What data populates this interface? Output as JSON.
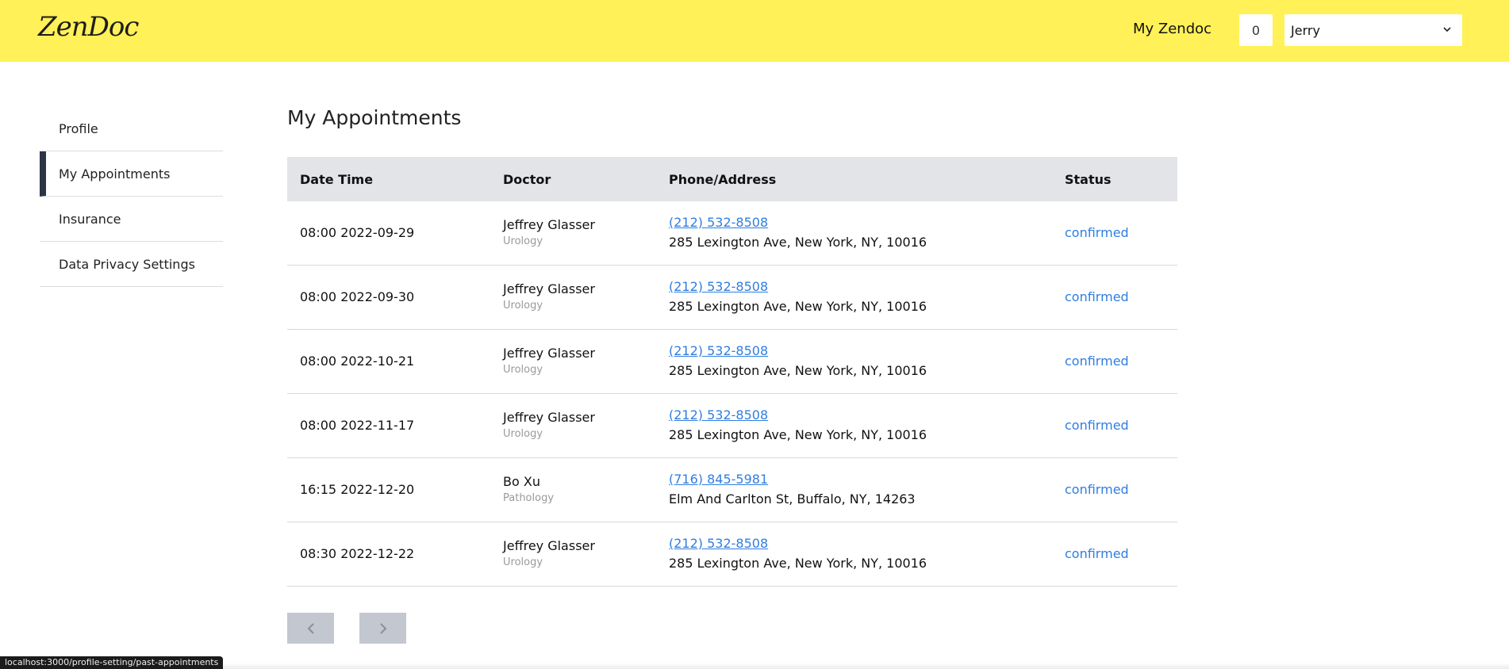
{
  "header": {
    "logo": "ZenDoc",
    "my_zendoc": "My Zendoc",
    "counter": "0",
    "user": "Jerry",
    "colors": {
      "background": "#fff157"
    }
  },
  "sidebar": {
    "items": [
      {
        "label": "Profile",
        "active": false
      },
      {
        "label": "My Appointments",
        "active": true
      },
      {
        "label": "Insurance",
        "active": false
      },
      {
        "label": "Data Privacy Settings",
        "active": false
      }
    ]
  },
  "main": {
    "title": "My Appointments",
    "columns": [
      "Date Time",
      "Doctor",
      "Phone/Address",
      "Status"
    ],
    "rows": [
      {
        "datetime": "08:00 2022-09-29",
        "doctor": "Jeffrey Glasser",
        "specialty": "Urology",
        "phone": "(212) 532-8508",
        "address": "285 Lexington Ave, New York, NY, 10016",
        "status": "confirmed"
      },
      {
        "datetime": "08:00 2022-09-30",
        "doctor": "Jeffrey Glasser",
        "specialty": "Urology",
        "phone": "(212) 532-8508",
        "address": "285 Lexington Ave, New York, NY, 10016",
        "status": "confirmed"
      },
      {
        "datetime": "08:00 2022-10-21",
        "doctor": "Jeffrey Glasser",
        "specialty": "Urology",
        "phone": "(212) 532-8508",
        "address": "285 Lexington Ave, New York, NY, 10016",
        "status": "confirmed"
      },
      {
        "datetime": "08:00 2022-11-17",
        "doctor": "Jeffrey Glasser",
        "specialty": "Urology",
        "phone": "(212) 532-8508",
        "address": "285 Lexington Ave, New York, NY, 10016",
        "status": "confirmed"
      },
      {
        "datetime": "16:15 2022-12-20",
        "doctor": "Bo Xu",
        "specialty": "Pathology",
        "phone": "(716) 845-5981",
        "address": "Elm And Carlton St, Buffalo, NY, 14263",
        "status": "confirmed"
      },
      {
        "datetime": "08:30 2022-12-22",
        "doctor": "Jeffrey Glasser",
        "specialty": "Urology",
        "phone": "(212) 532-8508",
        "address": "285 Lexington Ave, New York, NY, 10016",
        "status": "confirmed"
      }
    ],
    "pagination": {
      "prev_icon": "chevron-left-icon",
      "next_icon": "chevron-right-icon"
    }
  },
  "statusbar": {
    "url": "localhost:3000/profile-setting/past-appointments"
  }
}
